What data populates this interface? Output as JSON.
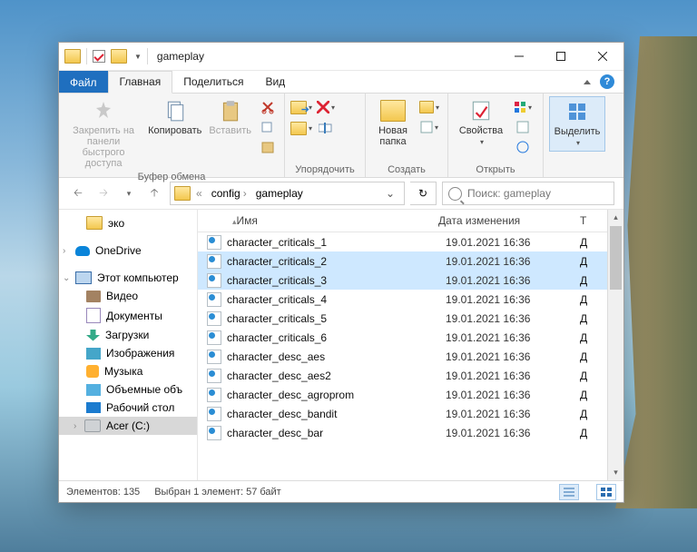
{
  "title": "gameplay",
  "tabs": {
    "file": "Файл",
    "home": "Главная",
    "share": "Поделиться",
    "view": "Вид"
  },
  "ribbon": {
    "pin": "Закрепить на панели быстрого доступа",
    "copy": "Копировать",
    "paste": "Вставить",
    "grp_clipboard": "Буфер обмена",
    "grp_organize": "Упорядочить",
    "newfolder": "Новая папка",
    "grp_create": "Создать",
    "props": "Свойства",
    "grp_open": "Открыть",
    "select": "Выделить"
  },
  "breadcrumbs": [
    "config",
    "gameplay"
  ],
  "search_placeholder": "Поиск: gameplay",
  "columns": {
    "name": "Имя",
    "date": "Дата изменения",
    "type": "Т"
  },
  "nav": {
    "eco": "эко",
    "onedrive": "OneDrive",
    "thispc": "Этот компьютер",
    "video": "Видео",
    "documents": "Документы",
    "downloads": "Загрузки",
    "pictures": "Изображения",
    "music": "Музыка",
    "volumes": "Объемные объ",
    "desktop": "Рабочий стол",
    "acer": "Acer (C:)"
  },
  "files": [
    {
      "name": "character_criticals_1",
      "date": "19.01.2021 16:36",
      "type": "Д",
      "sel": false
    },
    {
      "name": "character_criticals_2",
      "date": "19.01.2021 16:36",
      "type": "Д",
      "sel": true
    },
    {
      "name": "character_criticals_3",
      "date": "19.01.2021 16:36",
      "type": "Д",
      "sel": true
    },
    {
      "name": "character_criticals_4",
      "date": "19.01.2021 16:36",
      "type": "Д",
      "sel": false
    },
    {
      "name": "character_criticals_5",
      "date": "19.01.2021 16:36",
      "type": "Д",
      "sel": false
    },
    {
      "name": "character_criticals_6",
      "date": "19.01.2021 16:36",
      "type": "Д",
      "sel": false
    },
    {
      "name": "character_desc_aes",
      "date": "19.01.2021 16:36",
      "type": "Д",
      "sel": false
    },
    {
      "name": "character_desc_aes2",
      "date": "19.01.2021 16:36",
      "type": "Д",
      "sel": false
    },
    {
      "name": "character_desc_agroprom",
      "date": "19.01.2021 16:36",
      "type": "Д",
      "sel": false
    },
    {
      "name": "character_desc_bandit",
      "date": "19.01.2021 16:36",
      "type": "Д",
      "sel": false
    },
    {
      "name": "character_desc_bar",
      "date": "19.01.2021 16:36",
      "type": "Д",
      "sel": false
    }
  ],
  "status": {
    "count": "Элементов: 135",
    "sel": "Выбран 1 элемент: 57 байт"
  }
}
